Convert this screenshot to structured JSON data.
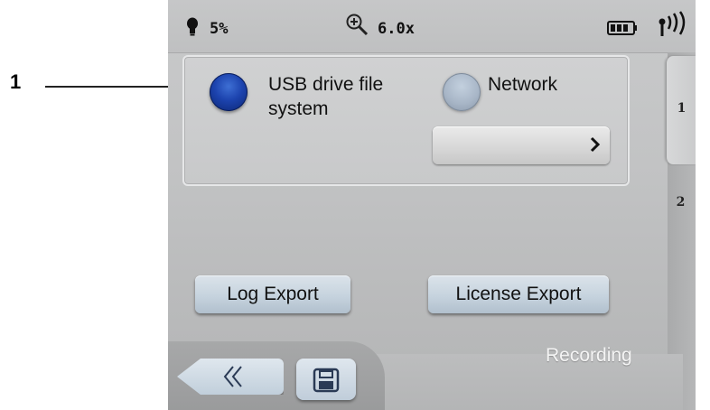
{
  "callout": {
    "number": "1"
  },
  "status_bar": {
    "light_level": "5%",
    "zoom": "6.0x",
    "icons": [
      "bulb-icon",
      "zoom-icon",
      "battery-icon",
      "signal-icon"
    ]
  },
  "tabs": [
    {
      "label": "1",
      "selected": true
    },
    {
      "label": "2",
      "selected": false
    }
  ],
  "storage": {
    "options": [
      {
        "label": "USB drive file system",
        "selected": true
      },
      {
        "label": "Network",
        "selected": false
      }
    ],
    "network_select_value": "",
    "network_select_icon": "chevron-right-icon"
  },
  "buttons": {
    "log_export": "Log Export",
    "license_export": "License Export"
  },
  "footer": {
    "section_label": "Recording",
    "back_icon": "double-chevron-left-icon",
    "save_icon": "save-icon"
  },
  "colors": {
    "selected_radio": "#1c43ae",
    "unselected_radio": "#a8b6c7",
    "button_face": "#c6d3de"
  }
}
